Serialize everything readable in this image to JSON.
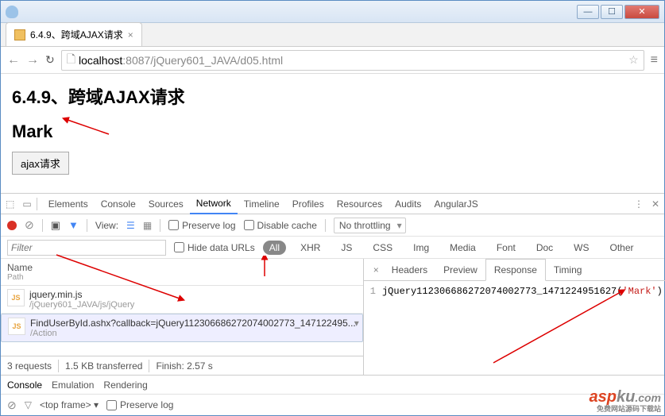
{
  "window": {
    "tab_title": "6.4.9、跨域AJAX请求",
    "url_host": "localhost",
    "url_port": ":8087",
    "url_path": "/jQuery601_JAVA/d05.html"
  },
  "page": {
    "heading": "6.4.9、跨域AJAX请求",
    "result": "Mark",
    "button": "ajax请求"
  },
  "devtools": {
    "tabs": [
      "Elements",
      "Console",
      "Sources",
      "Network",
      "Timeline",
      "Profiles",
      "Resources",
      "Audits",
      "AngularJS"
    ],
    "active_tab": "Network",
    "view_label": "View:",
    "preserve_log": "Preserve log",
    "disable_cache": "Disable cache",
    "throttling": "No throttling",
    "filter_placeholder": "Filter",
    "hide_data_urls": "Hide data URLs",
    "type_filters": [
      "All",
      "XHR",
      "JS",
      "CSS",
      "Img",
      "Media",
      "Font",
      "Doc",
      "WS",
      "Other"
    ],
    "active_filter": "All",
    "list": {
      "name_hdr": "Name",
      "path_hdr": "Path",
      "items": [
        {
          "name": "jquery.min.js",
          "path": "/jQuery601_JAVA/js/jQuery"
        },
        {
          "name": "FindUserById.ashx?callback=jQuery112306686272074002773_147122495...",
          "path": "/Action"
        }
      ]
    },
    "status": {
      "requests": "3 requests",
      "transferred": "1.5 KB transferred",
      "finish": "Finish: 2.57 s"
    },
    "detail": {
      "tabs": [
        "Headers",
        "Preview",
        "Response",
        "Timing"
      ],
      "active": "Response",
      "response_prefix": "jQuery112306686272074002773_1471224951627(",
      "response_str": "'Mark'",
      "response_suffix": ")"
    },
    "drawer": {
      "tabs": [
        "Console",
        "Emulation",
        "Rendering"
      ],
      "active": "Console",
      "frame": "<top frame>",
      "preserve_log": "Preserve log"
    }
  },
  "watermark": {
    "a": "asp",
    "b": "ku",
    "c": ".com",
    "cn": "免费网站源码下载站"
  }
}
